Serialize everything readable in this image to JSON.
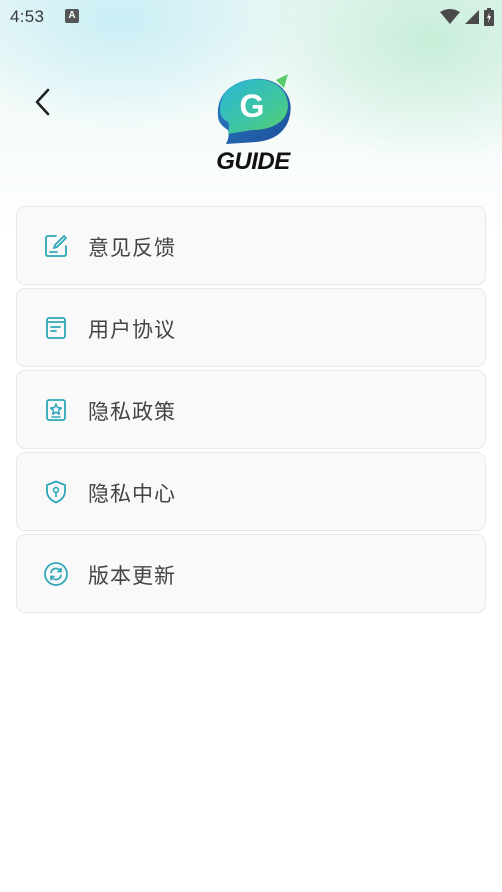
{
  "status_bar": {
    "time": "4:53",
    "notification_glyph": "A"
  },
  "header": {
    "back_icon": "chevron-left-icon",
    "logo_text": "GUIDE",
    "logo_letter": "G"
  },
  "menu": {
    "items": [
      {
        "label": "意见反馈",
        "icon": "feedback-edit-icon"
      },
      {
        "label": "用户协议",
        "icon": "document-icon"
      },
      {
        "label": "隐私政策",
        "icon": "star-badge-icon"
      },
      {
        "label": "隐私中心",
        "icon": "shield-icon"
      },
      {
        "label": "版本更新",
        "icon": "refresh-icon"
      }
    ]
  },
  "colors": {
    "icon_teal": "#2fa7b8",
    "text": "#444444",
    "card_bg": "#f9f9fa",
    "card_border": "#e8e8ea"
  }
}
